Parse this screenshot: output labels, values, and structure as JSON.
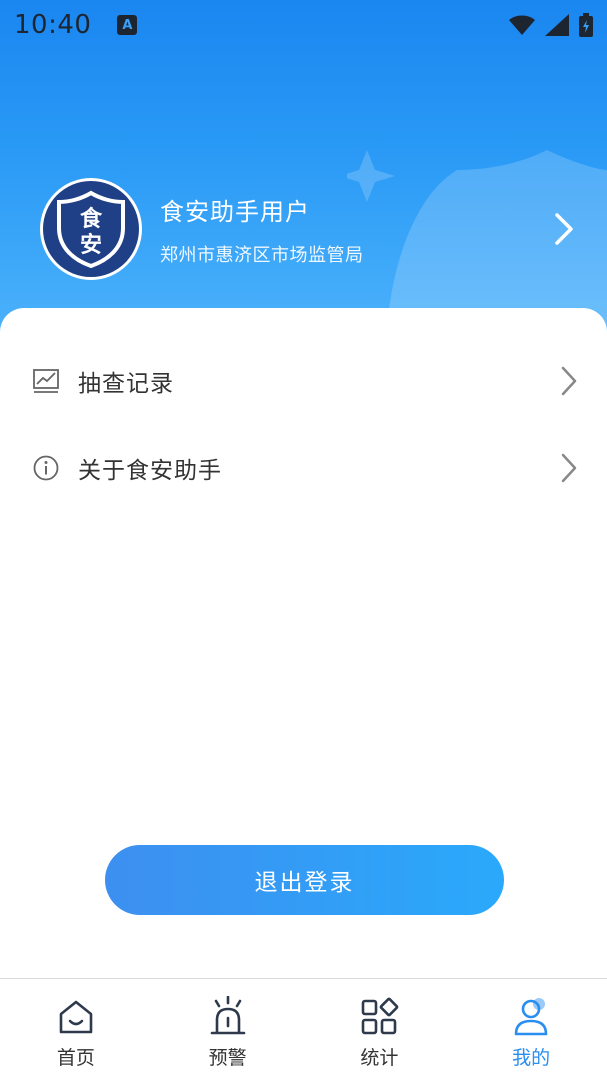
{
  "status_bar": {
    "time": "10:40",
    "notification_letter": "A",
    "icons": [
      "wifi-icon",
      "cell-signal-icon",
      "battery-icon"
    ]
  },
  "profile": {
    "avatar_text_top": "食",
    "avatar_text_bottom": "安",
    "name": "食安助手用户",
    "organization": "郑州市惠济区市场监管局"
  },
  "menu": {
    "items": [
      {
        "label": "抽查记录",
        "icon": "chart-line-icon"
      },
      {
        "label": "关于食安助手",
        "icon": "info-icon"
      }
    ]
  },
  "logout": {
    "label": "退出登录"
  },
  "tabbar": {
    "items": [
      {
        "label": "首页",
        "icon": "home-icon",
        "active": false
      },
      {
        "label": "预警",
        "icon": "alarm-icon",
        "active": false
      },
      {
        "label": "统计",
        "icon": "grid-icon",
        "active": false
      },
      {
        "label": "我的",
        "icon": "user-icon",
        "active": true
      }
    ]
  },
  "colors": {
    "header_top": "#1a86f0",
    "header_bottom": "#4cb2fb",
    "accent": "#2a8ef0",
    "avatar_badge": "#1f3f86"
  }
}
